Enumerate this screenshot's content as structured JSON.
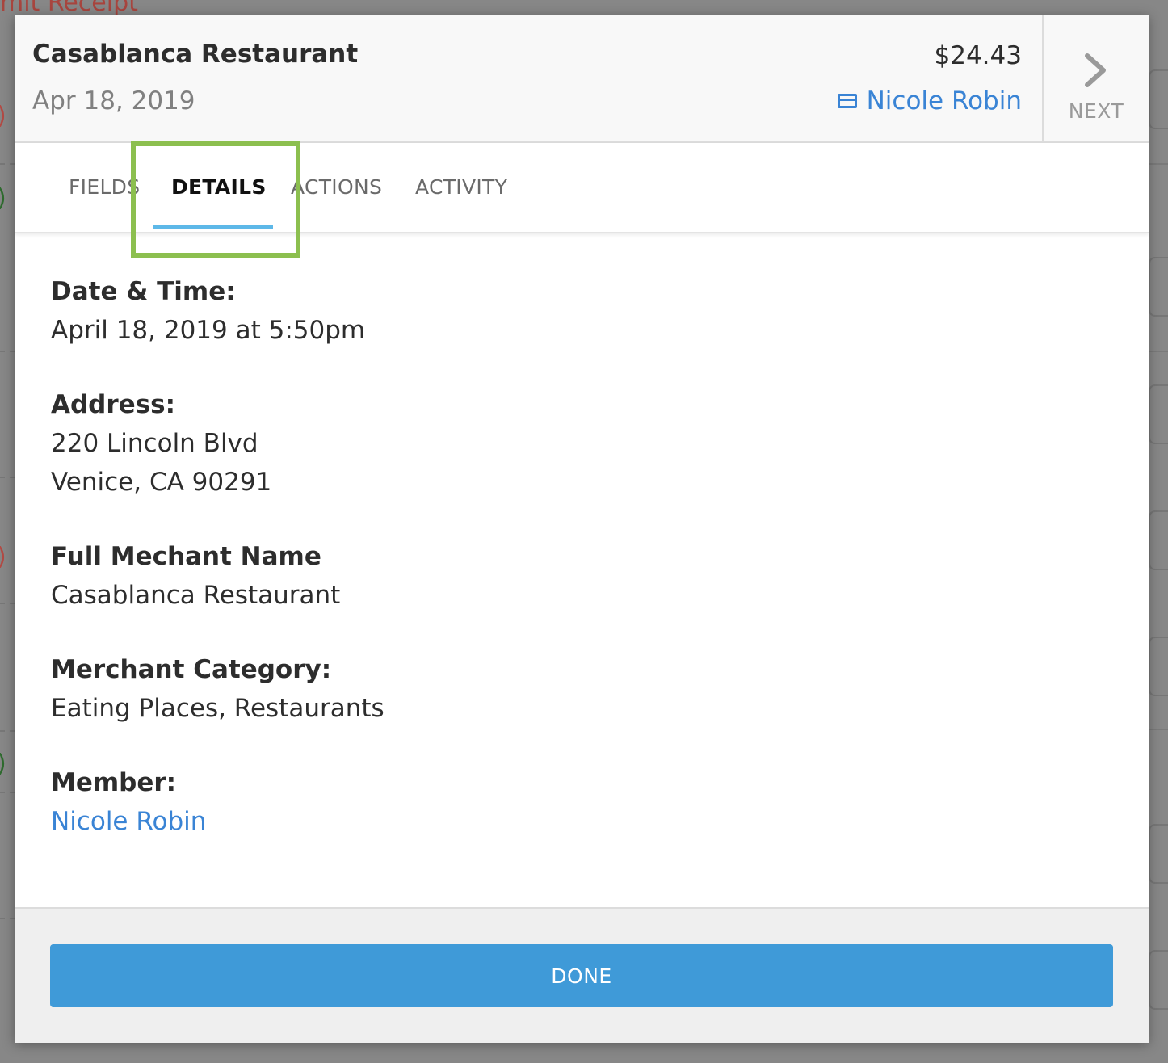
{
  "background": {
    "title_fragment": "mit Receipt"
  },
  "header": {
    "merchant": "Casablanca Restaurant",
    "date": "Apr 18, 2019",
    "amount": "$24.43",
    "member": "Nicole Robin",
    "next_label": "NEXT"
  },
  "tabs": [
    {
      "label": "FIELDS",
      "active": false
    },
    {
      "label": "DETAILS",
      "active": true
    },
    {
      "label": "ACTIONS",
      "active": false
    },
    {
      "label": "ACTIVITY",
      "active": false
    }
  ],
  "details": {
    "datetime_label": "Date & Time:",
    "datetime_value": "April 18, 2019 at 5:50pm",
    "address_label": "Address:",
    "address_line1": "220 Lincoln Blvd",
    "address_line2": "Venice, CA 90291",
    "full_name_label": "Full Mechant Name",
    "full_name_value": "Casablanca Restaurant",
    "category_label": "Merchant Category:",
    "category_value": "Eating Places, Restaurants",
    "member_label": "Member:",
    "member_value": "Nicole Robin"
  },
  "footer": {
    "done_label": "DONE"
  },
  "colors": {
    "accent_blue": "#3a84d5",
    "button_blue": "#3f9ad8",
    "tab_underline": "#5db8e8",
    "highlight_green": "#8cbf4f"
  }
}
